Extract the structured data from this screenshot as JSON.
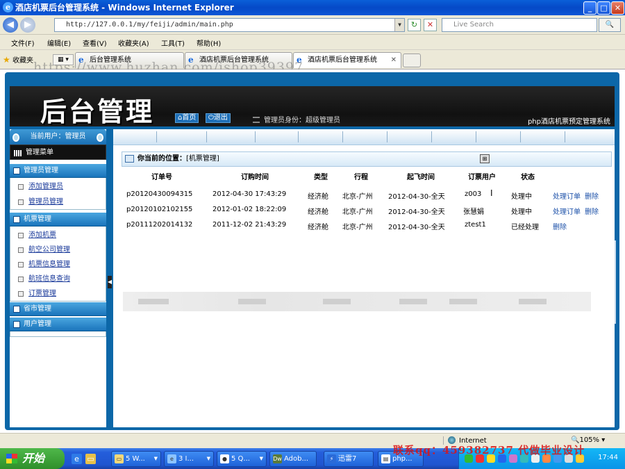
{
  "window": {
    "title": "酒店机票后台管理系统 - Windows Internet Explorer",
    "ie_glyph": "e",
    "buttons": {
      "minimize": "_",
      "maximize": "□",
      "close": "✕"
    }
  },
  "address_bar": {
    "url": "http://127.0.0.1/my/feiji/admin/main.php",
    "search_placeholder": "Live Search",
    "back": "◀",
    "forward": "▶",
    "refresh": "↻",
    "stop": "✕",
    "search_button": "🔍"
  },
  "menu": [
    "文件(F)",
    "编辑(E)",
    "查看(V)",
    "收藏夹(A)",
    "工具(T)",
    "帮助(H)"
  ],
  "tabs": {
    "favorites_label": "收藏夹",
    "items": [
      {
        "title": "后台管理系统"
      },
      {
        "title": "酒店机票后台管理系统"
      },
      {
        "title": "酒店机票后台管理系统"
      }
    ],
    "close_glyph": "✕"
  },
  "watermark_top": "https://www.huzhan.com/ishop39397",
  "header": {
    "logo": "后台管理",
    "home": "首页",
    "logout": "退出",
    "role_text": "管理员身份：超级管理员",
    "system_name": "php酒店机票预定管理系统"
  },
  "sidebar": {
    "current_user": "当前用户：管理员",
    "menu_title": "管理菜单",
    "sections": [
      {
        "title": "管理员管理",
        "items": [
          "添加管理员",
          "管理员管理"
        ]
      },
      {
        "title": "机票管理",
        "items": [
          "添加机票",
          "航空公司管理",
          "机票信息管理",
          "航班信息查询",
          "订票管理"
        ]
      },
      {
        "title": "省市管理",
        "items": []
      },
      {
        "title": "用户管理",
        "items": []
      }
    ]
  },
  "main": {
    "location_label": "你当前的位置：",
    "location_value": "[机票管理]",
    "table": {
      "headers": [
        "订单号",
        "订购时间",
        "类型",
        "行程",
        "起飞时间",
        "订票用户",
        "状态"
      ],
      "rows": [
        {
          "order_no": "p20120430094315",
          "order_time": "2012-04-30 17:43:29",
          "type": "经济舱",
          "route": "北京-广州",
          "depart": "2012-04-30-全天",
          "user": "z003",
          "status": "处理中",
          "actions": [
            "处理订单",
            "删除"
          ]
        },
        {
          "order_no": "p20120102102155",
          "order_time": "2012-01-02 18:22:09",
          "type": "经济舱",
          "route": "北京-广州",
          "depart": "2012-04-30-全天",
          "user": "张慧娟",
          "status": "处理中",
          "actions": [
            "处理订单",
            "删除"
          ]
        },
        {
          "order_no": "p20111202014132",
          "order_time": "2011-12-02 21:43:29",
          "type": "经济舱",
          "route": "北京-广州",
          "depart": "2012-04-30-全天",
          "user": "ztest1",
          "status": "已经处理",
          "actions": [
            "删除"
          ]
        }
      ]
    }
  },
  "status_bar": {
    "zone": "Internet",
    "zoom": "105%"
  },
  "watermark_bottom": "联系qq：459382737 代做毕业设计",
  "taskbar": {
    "start": "开始",
    "tasks": [
      "5 W...",
      "3 I...",
      "5 Q...",
      "Adob...",
      "迅雷7",
      "php..."
    ],
    "clock": "17:44"
  }
}
